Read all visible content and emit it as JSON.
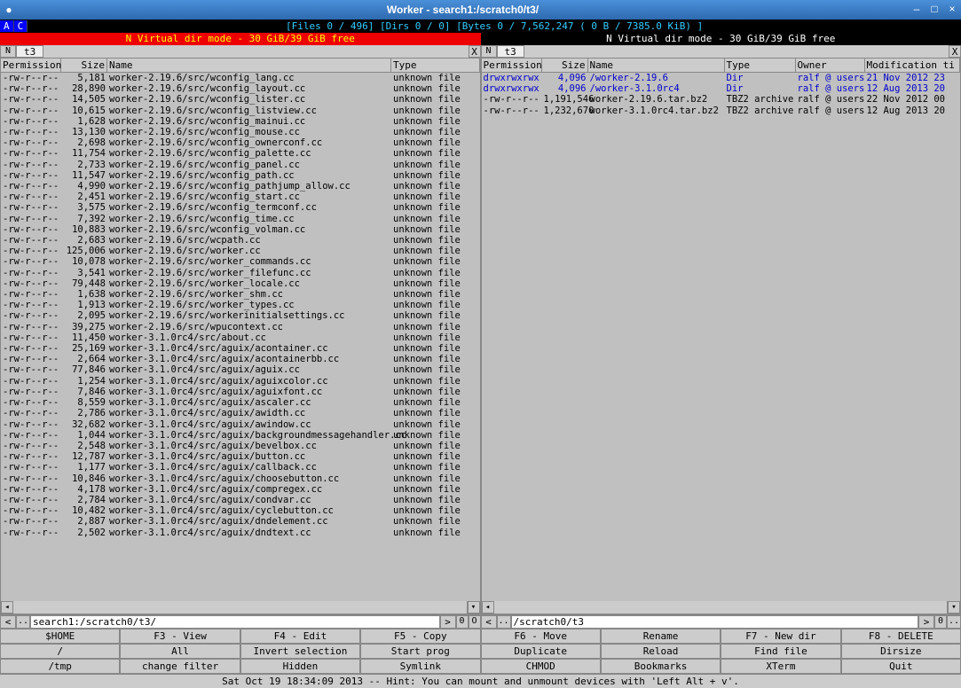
{
  "title": "Worker - search1:/scratch0/t3/",
  "ac": {
    "a": "A",
    "c": "C",
    "stats": "[Files   0 / 496]   [Dirs  0 /  0]   [Bytes        0 / 7,562,247  (        0 B / 7385.0 KiB) ]"
  },
  "vdir_left": "N        Virtual dir mode - 30 GiB/39 GiB free",
  "vdir_right": "N               Virtual dir mode - 30 GiB/39 GiB free",
  "tab_n": "N",
  "tab_x": "X",
  "tab_name": "t3",
  "headers": {
    "perm": "Permission",
    "size": "Size",
    "name": "Name",
    "type": "Type",
    "owner": "Owner",
    "mod": "Modification ti"
  },
  "path_left": "search1:/scratch0/t3/",
  "path_right": "/scratch0/t3",
  "hide_left": "0",
  "hide_right": "0",
  "arrow_left": "<",
  "arrow_right": ">",
  "dots": "..",
  "rows_left": [
    {
      "p": "-rw-r--r--",
      "s": "5,181",
      "n": "worker-2.19.6/src/wconfig_lang.cc",
      "t": "unknown file"
    },
    {
      "p": "-rw-r--r--",
      "s": "28,890",
      "n": "worker-2.19.6/src/wconfig_layout.cc",
      "t": "unknown file"
    },
    {
      "p": "-rw-r--r--",
      "s": "14,505",
      "n": "worker-2.19.6/src/wconfig_lister.cc",
      "t": "unknown file"
    },
    {
      "p": "-rw-r--r--",
      "s": "10,615",
      "n": "worker-2.19.6/src/wconfig_listview.cc",
      "t": "unknown file"
    },
    {
      "p": "-rw-r--r--",
      "s": "1,628",
      "n": "worker-2.19.6/src/wconfig_mainui.cc",
      "t": "unknown file"
    },
    {
      "p": "-rw-r--r--",
      "s": "13,130",
      "n": "worker-2.19.6/src/wconfig_mouse.cc",
      "t": "unknown file"
    },
    {
      "p": "-rw-r--r--",
      "s": "2,698",
      "n": "worker-2.19.6/src/wconfig_ownerconf.cc",
      "t": "unknown file"
    },
    {
      "p": "-rw-r--r--",
      "s": "11,754",
      "n": "worker-2.19.6/src/wconfig_palette.cc",
      "t": "unknown file"
    },
    {
      "p": "-rw-r--r--",
      "s": "2,733",
      "n": "worker-2.19.6/src/wconfig_panel.cc",
      "t": "unknown file"
    },
    {
      "p": "-rw-r--r--",
      "s": "11,547",
      "n": "worker-2.19.6/src/wconfig_path.cc",
      "t": "unknown file"
    },
    {
      "p": "-rw-r--r--",
      "s": "4,990",
      "n": "worker-2.19.6/src/wconfig_pathjump_allow.cc",
      "t": "unknown file"
    },
    {
      "p": "-rw-r--r--",
      "s": "2,451",
      "n": "worker-2.19.6/src/wconfig_start.cc",
      "t": "unknown file"
    },
    {
      "p": "-rw-r--r--",
      "s": "3,575",
      "n": "worker-2.19.6/src/wconfig_termconf.cc",
      "t": "unknown file"
    },
    {
      "p": "-rw-r--r--",
      "s": "7,392",
      "n": "worker-2.19.6/src/wconfig_time.cc",
      "t": "unknown file"
    },
    {
      "p": "-rw-r--r--",
      "s": "10,883",
      "n": "worker-2.19.6/src/wconfig_volman.cc",
      "t": "unknown file"
    },
    {
      "p": "-rw-r--r--",
      "s": "2,683",
      "n": "worker-2.19.6/src/wcpath.cc",
      "t": "unknown file"
    },
    {
      "p": "-rw-r--r--",
      "s": "125,006",
      "n": "worker-2.19.6/src/worker.cc",
      "t": "unknown file"
    },
    {
      "p": "-rw-r--r--",
      "s": "10,078",
      "n": "worker-2.19.6/src/worker_commands.cc",
      "t": "unknown file"
    },
    {
      "p": "-rw-r--r--",
      "s": "3,541",
      "n": "worker-2.19.6/src/worker_filefunc.cc",
      "t": "unknown file"
    },
    {
      "p": "-rw-r--r--",
      "s": "79,448",
      "n": "worker-2.19.6/src/worker_locale.cc",
      "t": "unknown file"
    },
    {
      "p": "-rw-r--r--",
      "s": "1,638",
      "n": "worker-2.19.6/src/worker_shm.cc",
      "t": "unknown file"
    },
    {
      "p": "-rw-r--r--",
      "s": "1,913",
      "n": "worker-2.19.6/src/worker_types.cc",
      "t": "unknown file"
    },
    {
      "p": "-rw-r--r--",
      "s": "2,095",
      "n": "worker-2.19.6/src/workerinitialsettings.cc",
      "t": "unknown file"
    },
    {
      "p": "-rw-r--r--",
      "s": "39,275",
      "n": "worker-2.19.6/src/wpucontext.cc",
      "t": "unknown file"
    },
    {
      "p": "-rw-r--r--",
      "s": "11,450",
      "n": "worker-3.1.0rc4/src/about.cc",
      "t": "unknown file"
    },
    {
      "p": "-rw-r--r--",
      "s": "25,169",
      "n": "worker-3.1.0rc4/src/aguix/acontainer.cc",
      "t": "unknown file"
    },
    {
      "p": "-rw-r--r--",
      "s": "2,664",
      "n": "worker-3.1.0rc4/src/aguix/acontainerbb.cc",
      "t": "unknown file"
    },
    {
      "p": "-rw-r--r--",
      "s": "77,846",
      "n": "worker-3.1.0rc4/src/aguix/aguix.cc",
      "t": "unknown file"
    },
    {
      "p": "-rw-r--r--",
      "s": "1,254",
      "n": "worker-3.1.0rc4/src/aguix/aguixcolor.cc",
      "t": "unknown file"
    },
    {
      "p": "-rw-r--r--",
      "s": "7,846",
      "n": "worker-3.1.0rc4/src/aguix/aguixfont.cc",
      "t": "unknown file"
    },
    {
      "p": "-rw-r--r--",
      "s": "8,559",
      "n": "worker-3.1.0rc4/src/aguix/ascaler.cc",
      "t": "unknown file"
    },
    {
      "p": "-rw-r--r--",
      "s": "2,786",
      "n": "worker-3.1.0rc4/src/aguix/awidth.cc",
      "t": "unknown file"
    },
    {
      "p": "-rw-r--r--",
      "s": "32,682",
      "n": "worker-3.1.0rc4/src/aguix/awindow.cc",
      "t": "unknown file"
    },
    {
      "p": "-rw-r--r--",
      "s": "1,044",
      "n": "worker-3.1.0rc4/src/aguix/backgroundmessagehandler.cc",
      "t": "unknown file"
    },
    {
      "p": "-rw-r--r--",
      "s": "2,548",
      "n": "worker-3.1.0rc4/src/aguix/bevelbox.cc",
      "t": "unknown file"
    },
    {
      "p": "-rw-r--r--",
      "s": "12,787",
      "n": "worker-3.1.0rc4/src/aguix/button.cc",
      "t": "unknown file"
    },
    {
      "p": "-rw-r--r--",
      "s": "1,177",
      "n": "worker-3.1.0rc4/src/aguix/callback.cc",
      "t": "unknown file"
    },
    {
      "p": "-rw-r--r--",
      "s": "10,846",
      "n": "worker-3.1.0rc4/src/aguix/choosebutton.cc",
      "t": "unknown file"
    },
    {
      "p": "-rw-r--r--",
      "s": "4,178",
      "n": "worker-3.1.0rc4/src/aguix/compregex.cc",
      "t": "unknown file"
    },
    {
      "p": "-rw-r--r--",
      "s": "2,784",
      "n": "worker-3.1.0rc4/src/aguix/condvar.cc",
      "t": "unknown file"
    },
    {
      "p": "-rw-r--r--",
      "s": "10,482",
      "n": "worker-3.1.0rc4/src/aguix/cyclebutton.cc",
      "t": "unknown file"
    },
    {
      "p": "-rw-r--r--",
      "s": "2,887",
      "n": "worker-3.1.0rc4/src/aguix/dndelement.cc",
      "t": "unknown file"
    },
    {
      "p": "-rw-r--r--",
      "s": "2,502",
      "n": "worker-3.1.0rc4/src/aguix/dndtext.cc",
      "t": "unknown file"
    }
  ],
  "rows_right": [
    {
      "p": "drwxrwxrwx",
      "s": "4,096",
      "n": "/worker-2.19.6",
      "t": "Dir",
      "o": "ralf @ users",
      "m": "21 Nov 2012 23",
      "dir": true
    },
    {
      "p": "drwxrwxrwx",
      "s": "4,096",
      "n": "/worker-3.1.0rc4",
      "t": "Dir",
      "o": "ralf @ users",
      "m": "12 Aug 2013 20",
      "dir": true
    },
    {
      "p": "-rw-r--r--",
      "s": "1,191,546",
      "n": "worker-2.19.6.tar.bz2",
      "t": "TBZ2 archive",
      "o": "ralf @ users",
      "m": "22 Nov 2012 00"
    },
    {
      "p": "-rw-r--r--",
      "s": "1,232,670",
      "n": "worker-3.1.0rc4.tar.bz2",
      "t": "TBZ2 archive",
      "o": "ralf @ users",
      "m": "12 Aug 2013 20"
    }
  ],
  "buttons": [
    "$HOME",
    "F3 - View",
    "F4 - Edit",
    "F5 - Copy",
    "F6 - Move",
    "Rename",
    "F7 - New dir",
    "F8 - DELETE",
    "/",
    "All",
    "Invert selection",
    "Start prog",
    "Duplicate",
    "Reload",
    "Find file",
    "Dirsize",
    "/tmp",
    "change filter",
    "Hidden",
    "Symlink",
    "CHMOD",
    "Bookmarks",
    "XTerm",
    "Quit"
  ],
  "status": "Sat Oct 19 18:34:09 2013 -- Hint: You can mount and unmount devices with 'Left Alt + v'."
}
